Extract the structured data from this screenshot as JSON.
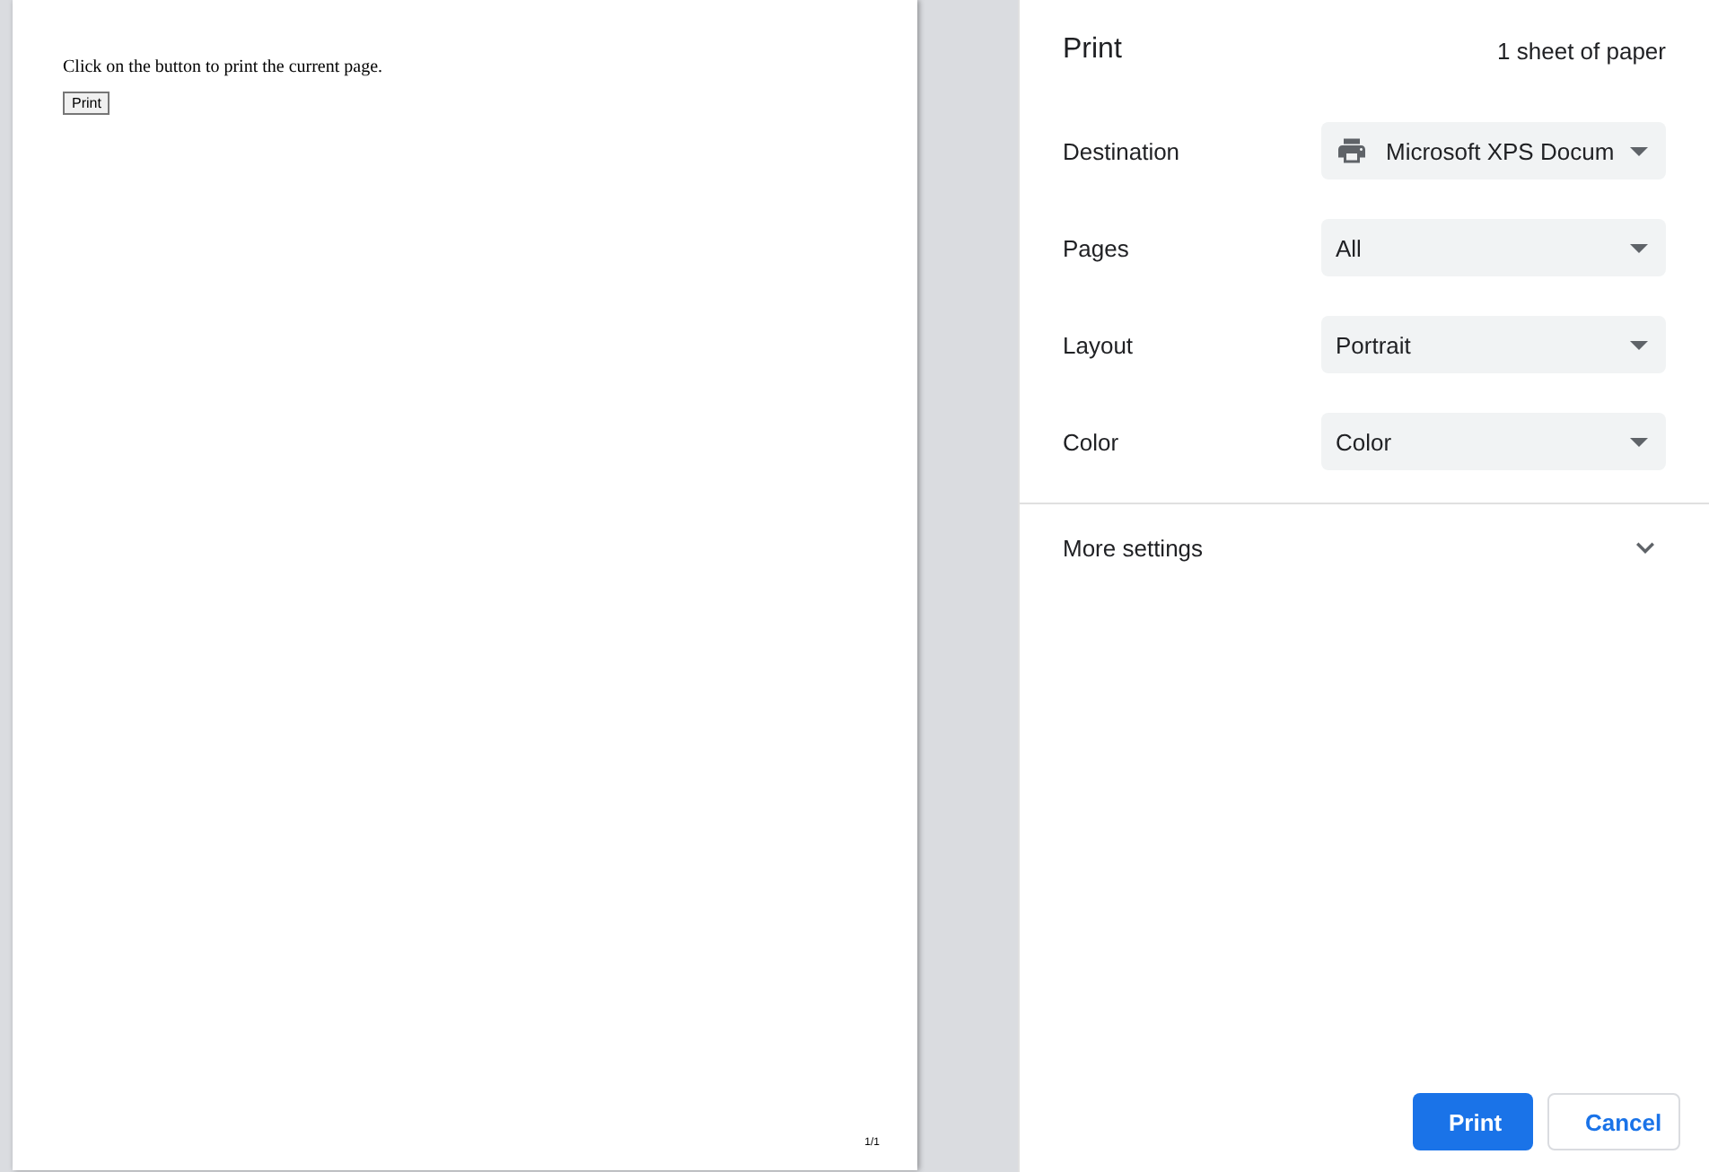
{
  "preview": {
    "text": "Click on the button to print the current page.",
    "button": "Print",
    "page_number": "1/1"
  },
  "panel": {
    "title": "Print",
    "sheets": "1 sheet of paper",
    "settings": [
      {
        "label": "Destination",
        "value": "Microsoft XPS Docum",
        "kind": "printer"
      },
      {
        "label": "Pages",
        "value": "All",
        "kind": "select"
      },
      {
        "label": "Layout",
        "value": "Portrait",
        "kind": "select"
      },
      {
        "label": "Color",
        "value": "Color",
        "kind": "select"
      }
    ],
    "more_settings": {
      "label": "More settings",
      "expanded": false
    },
    "buttons": [
      {
        "label": "Print",
        "kind": "primary"
      },
      {
        "label": "Cancel",
        "kind": "secondary"
      }
    ]
  }
}
